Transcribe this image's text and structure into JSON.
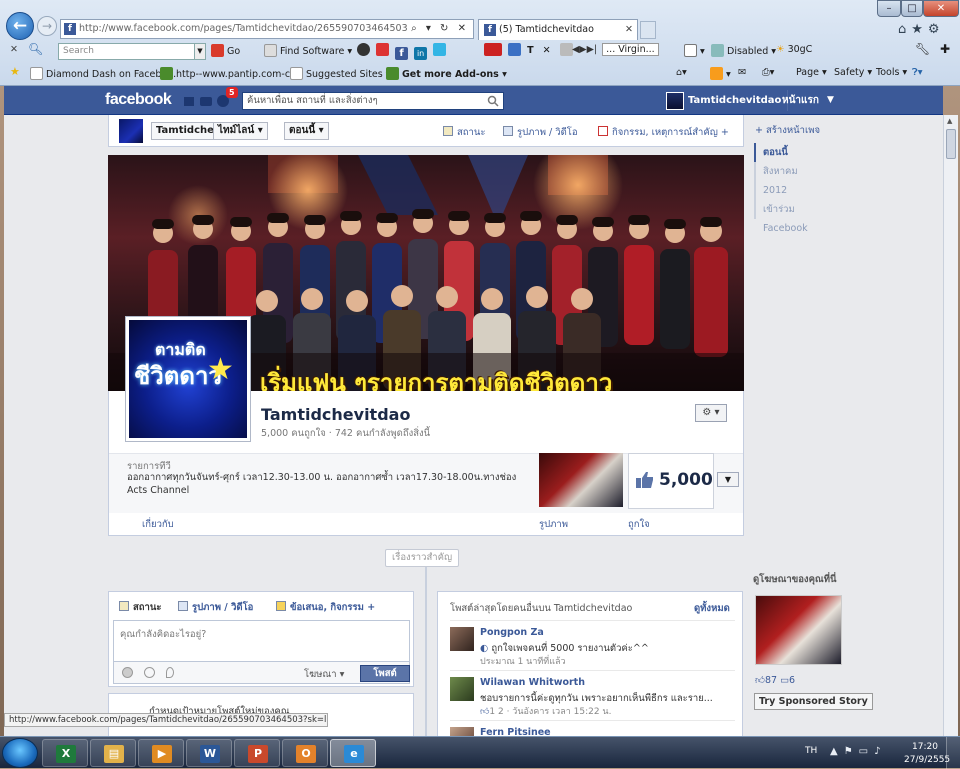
{
  "browser": {
    "address": "http://www.facebook.com/pages/Tamtidchevitdao/265590703464503",
    "address_domain": "facebook.com",
    "tab_title": "(5) Tamtidchevitdao",
    "toolbar1": {
      "search_placeholder": "Search",
      "go_label": "Go",
      "find_software": "Find Software",
      "virgin_label": "... Virgin...",
      "disabled_label": "Disabled",
      "weather": "30gC"
    },
    "favorites": [
      "Diamond Dash on Facebo...",
      "http--www.pantip.com-c...",
      "Suggested Sites",
      "Get more Add-ons"
    ],
    "command_bar": [
      "Page",
      "Safety",
      "Tools"
    ]
  },
  "fb": {
    "logo": "facebook",
    "notif_count": "5",
    "search_placeholder": "ค้นหาเพื่อน สถานที่ และสิ่งต่างๆ",
    "user_name": "Tamtidchevitdao",
    "home_label": "หน้าแรก"
  },
  "page_header": {
    "name": "Tamtidchevitdao",
    "timeline": "ไทม์ไลน์",
    "now": "ตอนนี้",
    "actions": [
      "สถานะ",
      "รูปภาพ / วิดีโอ",
      "กิจกรรม, เหตุการณ์สำคัญ +"
    ]
  },
  "cover": {
    "caption": "เริ่มแฟน ๆรายการตามติดชีวิตดาว",
    "profile_line1": "ตามติด",
    "profile_line2": "ชีวิตดาว"
  },
  "page": {
    "name": "Tamtidchevitdao",
    "stats": "5,000 คนถูกใจ · 742 คนกำลังพูดถึงสิ่งนี้",
    "about_label": "รายการทีวี",
    "about_text": "ออกอากาศทุกวันจันทร์-ศุกร์ เวลา12.30-13.00 น. ออกอากาศซ้ำ เวลา17.30-18.00น.ทางช่อง Acts Channel",
    "likes": "5,000",
    "about_link": "เกี่ยวกับ",
    "photos_link": "รูปภาพ",
    "likes_link": "ถูกใจ",
    "highlights_pill": "เรื่องราวสำคัญ"
  },
  "composer": {
    "tab_status": "สถานะ",
    "tab_photo": "รูปภาพ / วิดีโอ",
    "tab_offer": "ข้อเสนอ, กิจกรรม +",
    "placeholder": "คุณกำลังคิดอะไรอยู่?",
    "audience": "โฆษณา",
    "post_button": "โพสต์"
  },
  "below_card_text": "กำหนดเป้าหมายโพสต์ใหม่ของคุณ",
  "recent": {
    "title": "โพสต์ล่าสุดโดยคนอื่นบน Tamtidchevitdao",
    "see_all": "ดูทั้งหมด",
    "posts": [
      {
        "name": "Pongpon Za",
        "text": "ถูกใจเพจคนที่ 5000 รายงานตัวค่ะ^^",
        "meta": "ประมาณ 1 นาทีที่แล้ว"
      },
      {
        "name": "Wilawan Whitworth",
        "text": "ชอบรายการนี้ค่ะดูทุกวัน เพราะอยากเห็นพีธีกร และราย...",
        "meta": "1   2 · วันอังคาร เวลา 15:22 น."
      },
      {
        "name": "Fern Pitsinee",
        "text": "",
        "meta": ""
      }
    ]
  },
  "right_col": {
    "create_page": "+ สร้างหน้าเพจ",
    "years": [
      "ตอนนี้",
      "สิงหาคม",
      "2012",
      "เข้าร่วม Facebook"
    ],
    "ads_title": "ดูโฆษณาของคุณที่นี่",
    "ad_likes": "87",
    "ad_comments": "6",
    "try_sponsored": "Try Sponsored Story"
  },
  "statusbar": "http://www.facebook.com/pages/Tamtidchevitdao/265590703464503?sk=likes",
  "taskbar": {
    "lang": "TH",
    "time": "17:20",
    "date": "27/9/2555"
  }
}
